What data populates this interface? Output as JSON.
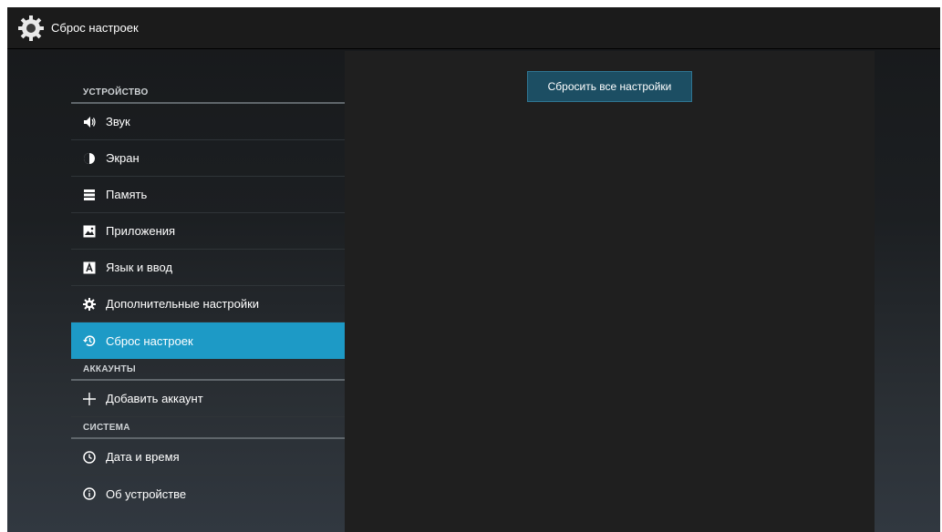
{
  "window": {
    "title": "Сброс настроек",
    "icon": "gear-icon"
  },
  "sidebar": {
    "sections": [
      {
        "header": "УСТРОЙСТВО",
        "items": [
          {
            "label": "Звук",
            "icon": "volume-icon"
          },
          {
            "label": "Экран",
            "icon": "brightness-icon"
          },
          {
            "label": "Память",
            "icon": "storage-icon"
          },
          {
            "label": "Приложения",
            "icon": "apps-icon"
          },
          {
            "label": "Язык и ввод",
            "icon": "language-icon"
          },
          {
            "label": "Дополнительные настройки",
            "icon": "gear-icon"
          },
          {
            "label": "Сброс настроек",
            "icon": "reset-icon",
            "selected": true
          }
        ]
      },
      {
        "header": "АККАУНТЫ",
        "items": [
          {
            "label": "Добавить аккаунт",
            "icon": "plus-icon"
          }
        ]
      },
      {
        "header": "СИСТЕМА",
        "items": [
          {
            "label": "Дата и время",
            "icon": "clock-icon"
          },
          {
            "label": "Об устройстве",
            "icon": "info-icon"
          }
        ]
      }
    ]
  },
  "main": {
    "reset_button_label": "Сбросить все настройки"
  },
  "colors": {
    "accent": "#1d9ac6",
    "button_bg": "#1c4e63"
  }
}
